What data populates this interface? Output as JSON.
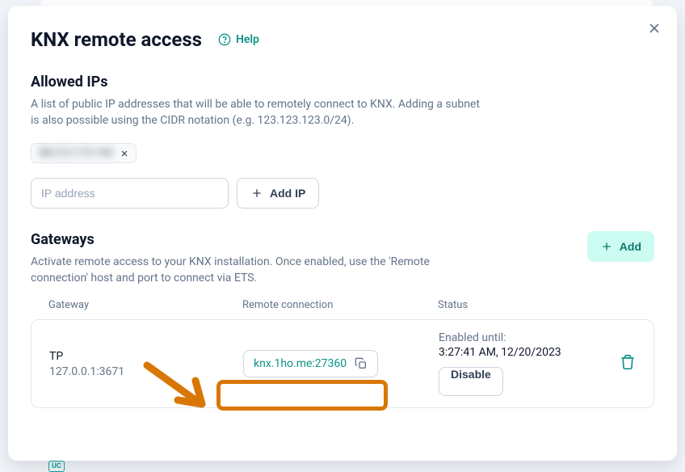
{
  "modal": {
    "title": "KNX remote access",
    "help_label": "Help"
  },
  "allowed_ips": {
    "title": "Allowed IPs",
    "description": "A list of public IP addresses that will be able to remotely connect to KNX. Adding a subnet is also possible using the CIDR notation (e.g. 123.123.123.0/24).",
    "existing_ip_masked": "88.212.173.194",
    "input_placeholder": "IP address",
    "add_button_label": "Add IP"
  },
  "gateways": {
    "title": "Gateways",
    "description": "Activate remote access to your KNX installation. Once enabled, use the 'Remote connection' host and port to connect via ETS.",
    "add_button_label": "Add",
    "columns": {
      "gateway": "Gateway",
      "remote": "Remote connection",
      "status": "Status"
    },
    "row": {
      "name": "TP",
      "address": "127.0.0.1:3671",
      "remote_host": "knx.1ho.me:27360",
      "status_prefix": "Enabled until:",
      "status_time": "3:27:41 AM, 12/20/2023",
      "disable_label": "Disable"
    }
  },
  "backdrop": {
    "uc": "UC"
  }
}
